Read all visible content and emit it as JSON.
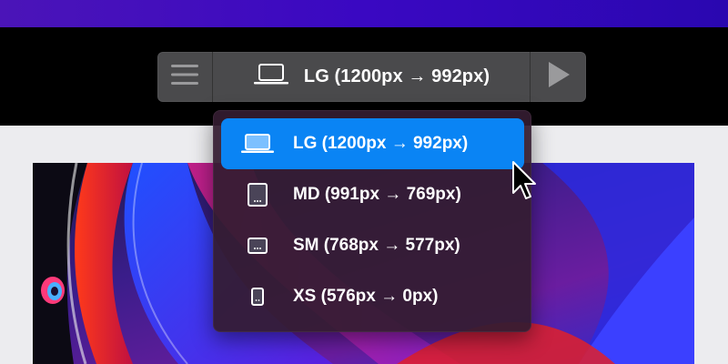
{
  "toolbar": {
    "menu_icon": "hamburger-menu-icon",
    "selected_icon": "laptop-icon",
    "selected_label": "LG (1200px → 992px)",
    "play_icon": "play-icon"
  },
  "dropdown": {
    "items": [
      {
        "label": "LG (1200px → 992px)",
        "icon": "laptop-icon",
        "selected": true
      },
      {
        "label": "MD (991px → 769px)",
        "icon": "tablet-portrait-icon",
        "selected": false
      },
      {
        "label": "SM (768px → 577px)",
        "icon": "tablet-landscape-icon",
        "selected": false
      },
      {
        "label": "XS (576px → 0px)",
        "icon": "phone-icon",
        "selected": false
      }
    ]
  },
  "colors": {
    "top_band": "#3a08c2",
    "toolbar": "#4a4a4c",
    "dropdown_bg": "#341c30",
    "selected_item": "#0a84f4",
    "page_bg": "#ececef"
  }
}
